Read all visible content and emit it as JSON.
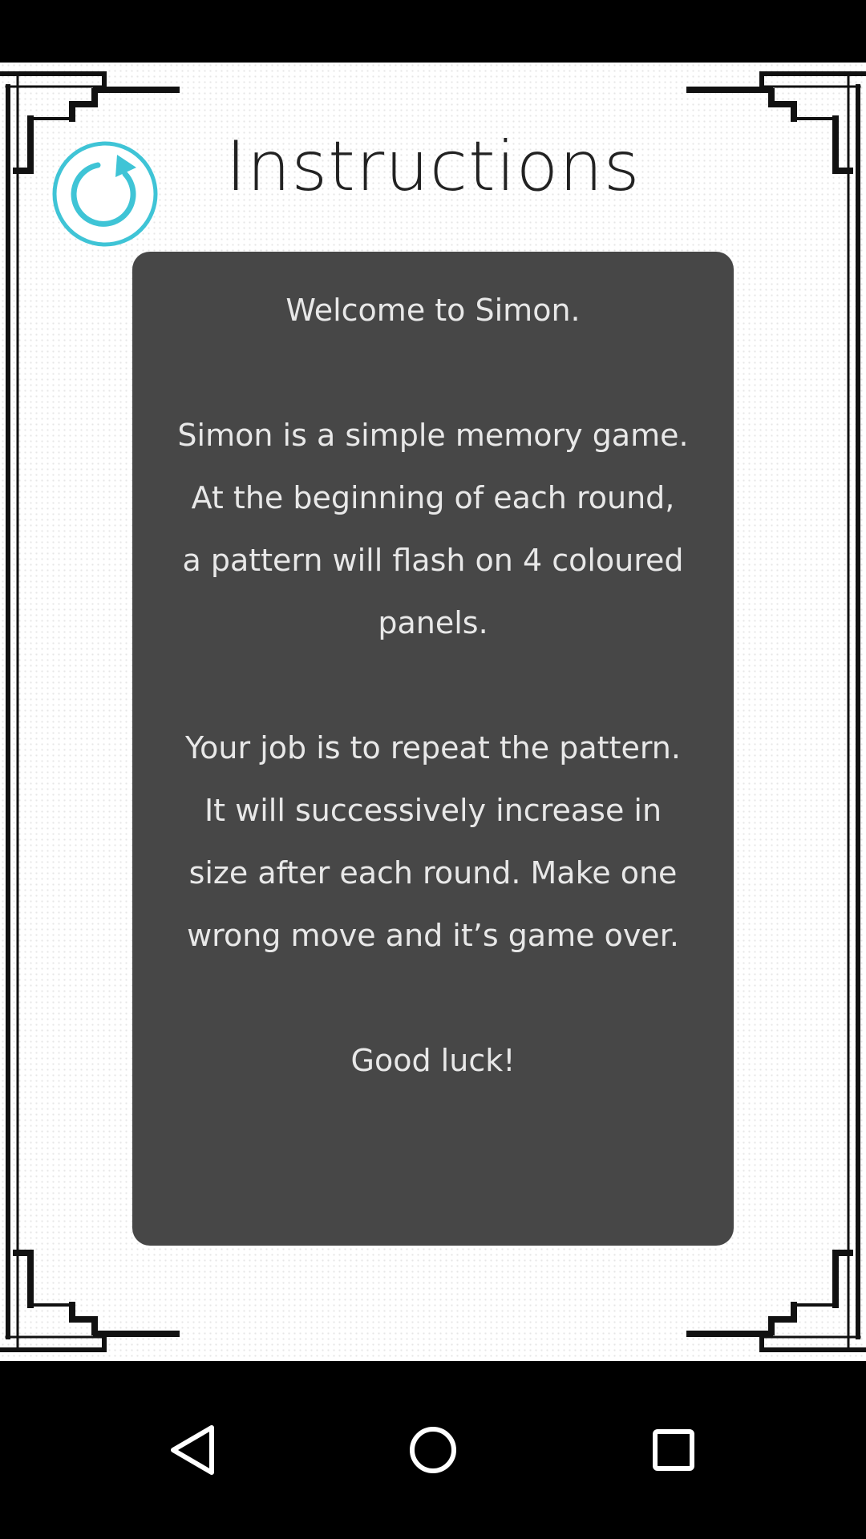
{
  "header": {
    "title": "Instructions",
    "refresh_icon": "refresh-icon"
  },
  "instructions": {
    "greeting": "Welcome to Simon.",
    "paragraph1_lines": [
      "Simon is a simple memory game.",
      "At the beginning of each round,",
      "a pattern will flash on 4 coloured",
      "panels."
    ],
    "paragraph2_lines": [
      "Your job is to repeat the pattern.",
      "It will successively increase in",
      "size after each round. Make one",
      "wrong move and it’s game over."
    ],
    "closing": "Good luck!"
  },
  "navigation": {
    "back_icon": "back-triangle-icon",
    "home_icon": "home-circle-icon",
    "recents_icon": "recents-square-icon"
  },
  "colors": {
    "accent": "#3fc4d6",
    "panel": "#474747",
    "panel_text": "#e8e8e8",
    "title_text": "#222222"
  }
}
